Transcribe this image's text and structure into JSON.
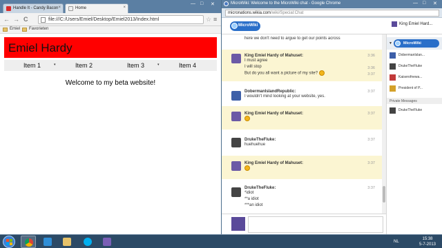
{
  "left_browser": {
    "tabs": [
      {
        "label": "Handle It - Candy Bacon"
      },
      {
        "label": "Home"
      }
    ],
    "close_glyph": "×",
    "window_controls": [
      "—",
      "□",
      "✕"
    ],
    "nav": {
      "back": "←",
      "forward": "→",
      "reload": "C"
    },
    "address": "file:///C:/Users/Emiel/Desktop/Emiel2013/Index.html",
    "bookmarks": [
      {
        "label": "Emiel",
        "icon": "folder-icon"
      },
      {
        "label": "Favorieten",
        "icon": "folder-icon"
      }
    ],
    "site": {
      "header": "Emiel Hardy",
      "nav_items": [
        "Item 1",
        "Item 2",
        "Item 3",
        "Item 4"
      ],
      "caret": "▾",
      "welcome": "Welcome to my beta website!"
    }
  },
  "right_browser": {
    "window_title": "MicroWiki: Welcome to the MicroWiki chat - Google Chrome",
    "url_host": "micronations.wikia.com",
    "url_path": "/wiki/Special:Chat",
    "logo_text": "MicroWiki",
    "current_user": "King Emiel Hard...",
    "messages": [
      {
        "user": "",
        "lines": [
          "here we don't need to argue to get our points across"
        ],
        "times": [
          ""
        ],
        "highlight": false
      },
      {
        "user": "King Emiel Hardy of Mahuset:",
        "lines": [
          "I must agree",
          "I will stop",
          "But do you all want a picture of my site? ☺"
        ],
        "times": [
          "3:36",
          "3:36",
          "3:37"
        ],
        "highlight": true
      },
      {
        "user": "DobermanIslandRepublic:",
        "lines": [
          "I wouldn't mind looking at your website, yes."
        ],
        "times": [
          "3:37"
        ],
        "highlight": false
      },
      {
        "user": "King Emiel Hardy of Mahuset:",
        "lines": [
          "☺"
        ],
        "times": [
          "3:37"
        ],
        "highlight": true
      },
      {
        "user": "DrukeTheFluke:",
        "lines": [
          "huehuehue"
        ],
        "times": [
          "3:37"
        ],
        "highlight": false
      },
      {
        "user": "King Emiel Hardy of Mahuset:",
        "lines": [
          "☺"
        ],
        "times": [
          "3:37"
        ],
        "highlight": true
      },
      {
        "user": "DrukeTheFluke:",
        "lines": [
          "*idiot",
          "**a idiot",
          "***an idiot"
        ],
        "times": [
          "3:37"
        ],
        "highlight": false
      }
    ],
    "sidebar": {
      "logo_text": "MicroWiki",
      "users": [
        "DobermanIslan...",
        "DrukeTheFluke",
        "Kaiserofnewa...",
        "President of P..."
      ],
      "private_label": "Private Messages",
      "private_users": [
        "DrukeTheFluke"
      ]
    }
  },
  "taskbar": {
    "language": "NL",
    "time": "15:38",
    "date": "5-7-2013"
  },
  "colors": {
    "site_header": "#ff0000",
    "highlight_row": "#fbf5d2",
    "title_bar": "#5b7fa3",
    "taskbar": "#2c4a66"
  }
}
